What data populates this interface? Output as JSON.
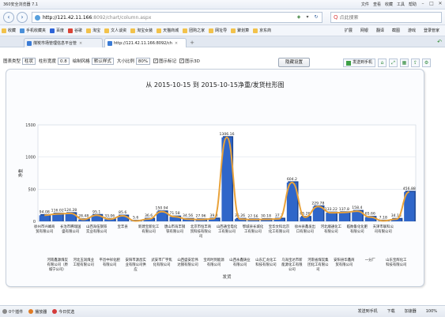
{
  "window": {
    "title": "360安全浏览器 7.1",
    "menu": [
      "文件",
      "查看",
      "收藏",
      "工具",
      "帮助"
    ]
  },
  "address": {
    "host": "http://121.42.11.166",
    "path": ":8092/chart/column.aspx",
    "search_placeholder": "点此搜索"
  },
  "bookmarks": {
    "items": [
      "收藏",
      "手机收藏夹",
      "百度",
      "谷歌",
      "淘宝",
      "文人谈资",
      "淘宝女装",
      "天猫商城",
      "团购之家",
      "网址导",
      "聚划算",
      "京东商"
    ],
    "right_items": [
      "扩展",
      "网银",
      "翻译",
      "截图",
      "游戏",
      "登录管家"
    ]
  },
  "tabs": [
    {
      "label": "煤炭市场管理信息平台管",
      "active": false
    },
    {
      "label": "http://121.42.11.166:8092/ch",
      "active": true
    }
  ],
  "toolbar": {
    "chart_type_label": "图表类型",
    "chart_type_value": "柱状",
    "column_width_label": "柱形宽度",
    "column_width_value": "0.8",
    "draw_style_label": "绘制风格",
    "draw_style_value": "默认样式",
    "size_ratio_label": "大小比例",
    "size_ratio_value": "80%",
    "show_mark_label": "图示标记",
    "show_3d_label": "图示3D",
    "reset_button": "隐藏设置",
    "send_phone": "发送到手机"
  },
  "status": {
    "items": [
      "0个插件",
      "播放器",
      "今日优选"
    ],
    "right_items": [
      "发送到手机",
      "下载",
      "加速器",
      "100%"
    ]
  },
  "chart_data": {
    "type": "bar",
    "title": "从 2015-10-15 到 2015-10-15净重/发货柱形图",
    "xlabel": "发货",
    "ylabel": "净重",
    "ylim": [
      0,
      1500
    ],
    "yticks": [
      0,
      500,
      1000,
      1500
    ],
    "categories": [
      "徐州市兴峰商贸有限公司",
      "河南鑫源煤炭有限公司（原城宁公司）",
      "长治市腾瑞国盛有限公司",
      "河北玉润煤业工程有限公司",
      "山西海伍钢铁实业有限公司",
      "平邑中祥化肥有限公司",
      "宝丰县",
      "安阳市源昌实业有限公司供应",
      "新建宝新化工有限公司",
      "武安市广宇焦化有限公司",
      "唐山市海丰钢铁有限公司",
      "山西盛安宏伟达钢有限公司",
      "北京市恒丰商贸科技有限公司",
      "宝鸡时到能源有限公司",
      "山西通宝电化工有限公司",
      "山西永鑫铸业有限公司",
      "鄂城县长城化工有限公司",
      "山东汇龙化工科技有限公司",
      "宝华文科北京化工有限公司",
      "乌海宝达市新能源化工有限公司",
      "徐州县鑫发出口有限公司",
      "河南省煤炭集团化工有限公司",
      "河北顺通化工有限公司",
      "安阳县华鑫商贸有限公司",
      "临朐鲁化化肥有限公司",
      "一分厂",
      "天津市联科公司有限公司",
      "山东宝辉化工科技有限公司"
    ],
    "values": [
      94.08,
      116.02,
      124.28,
      28.48,
      95.1,
      33.06,
      85.6,
      5.6,
      36.6,
      150.94,
      71.58,
      34.56,
      27.96,
      39.4,
      1306.16,
      35.26,
      27.56,
      30.18,
      37.7,
      604.2,
      65.26,
      229.78,
      133.22,
      137.8,
      158.4,
      65.66,
      7.18,
      34.18,
      456.88
    ],
    "data_labels": [
      "94.08",
      "116.02",
      "124.28",
      "28.48",
      "95.1",
      "33.06",
      "85.6",
      "5.6",
      "36.6",
      "150.94",
      "71.58",
      "34.56",
      "27.96",
      "39.4",
      "1306.16",
      "35.26",
      "27.56",
      "30.18",
      "37.7",
      "604.2",
      "65.26",
      "229.78",
      "133.22",
      "137.8",
      "158.4",
      "65.66",
      "7.18",
      "34.18",
      "456.88"
    ],
    "bar_color": "#2f66c9",
    "line_color": "#e9a23a",
    "grid": true
  }
}
